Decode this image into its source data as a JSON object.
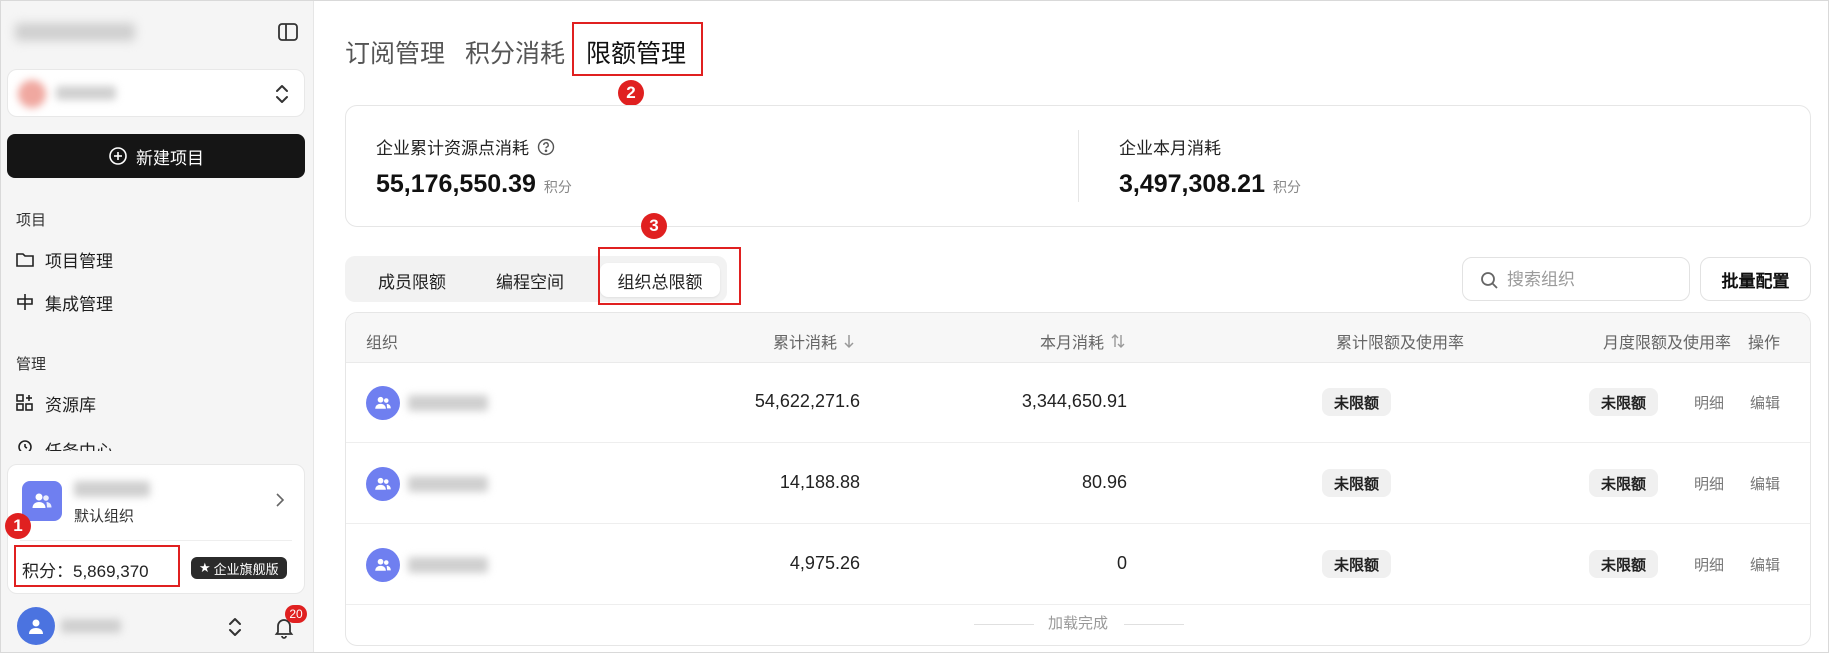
{
  "sidebar": {
    "new_project_label": "新建项目",
    "section_project": "项目",
    "items_project": [
      {
        "label": "项目管理",
        "icon": "folder-icon"
      },
      {
        "label": "集成管理",
        "icon": "integration-icon"
      }
    ],
    "section_manage": "管理",
    "items_manage": [
      {
        "label": "资源库",
        "icon": "grid-plus-icon"
      },
      {
        "label": "任务中心",
        "icon": "alarm-icon"
      }
    ],
    "org": {
      "subtitle": "默认组织",
      "points_label": "积分：",
      "points_value": "5,869,370",
      "edition_badge": "企业旗舰版"
    },
    "notifications_count": "20"
  },
  "markers": {
    "m1": "1",
    "m2": "2",
    "m3": "3"
  },
  "tabs": [
    {
      "label": "订阅管理",
      "active": false
    },
    {
      "label": "积分消耗",
      "active": false
    },
    {
      "label": "限额管理",
      "active": true
    }
  ],
  "stats": {
    "total": {
      "label": "企业累计资源点消耗",
      "value": "55,176,550.39",
      "unit": "积分"
    },
    "month": {
      "label": "企业本月消耗",
      "value": "3,497,308.21",
      "unit": "积分"
    }
  },
  "segments": [
    {
      "label": "成员限额",
      "active": false
    },
    {
      "label": "编程空间",
      "active": false
    },
    {
      "label": "组织总限额",
      "active": true
    }
  ],
  "search": {
    "placeholder": "搜索组织"
  },
  "batch_label": "批量配置",
  "table": {
    "headers": {
      "org": "组织",
      "total": "累计消耗",
      "month": "本月消耗",
      "total_limit": "累计限额及使用率",
      "month_limit": "月度限额及使用率",
      "ops": "操作"
    },
    "rows": [
      {
        "total": "54,622,271.6",
        "month": "3,344,650.91",
        "total_limit": "未限额",
        "month_limit": "未限额",
        "detail": "明细",
        "edit": "编辑"
      },
      {
        "total": "14,188.88",
        "month": "80.96",
        "total_limit": "未限额",
        "month_limit": "未限额",
        "detail": "明细",
        "edit": "编辑"
      },
      {
        "total": "4,975.26",
        "month": "0",
        "total_limit": "未限额",
        "month_limit": "未限额",
        "detail": "明细",
        "edit": "编辑"
      }
    ],
    "footer": "加载完成"
  },
  "colors": {
    "accent_red": "#e02020",
    "primary_dark": "#151515",
    "avatar_blue": "#6f7ff0"
  }
}
